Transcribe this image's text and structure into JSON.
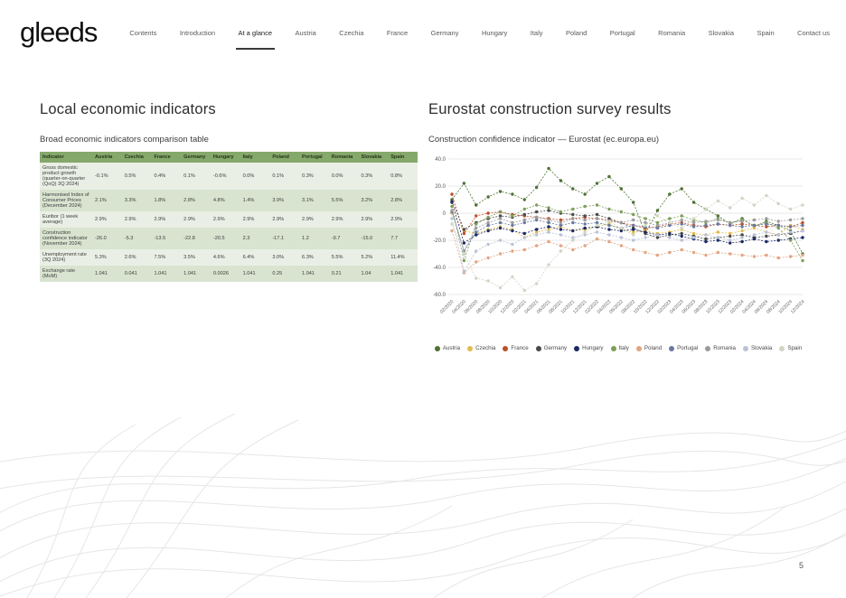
{
  "brand": {
    "logo": "gleeds"
  },
  "nav": {
    "items": [
      {
        "label": "Contents",
        "active": false
      },
      {
        "label": "Introduction",
        "active": false
      },
      {
        "label": "At a glance",
        "active": true
      },
      {
        "label": "Austria",
        "active": false
      },
      {
        "label": "Czechia",
        "active": false
      },
      {
        "label": "France",
        "active": false
      },
      {
        "label": "Germany",
        "active": false
      },
      {
        "label": "Hungary",
        "active": false
      },
      {
        "label": "Italy",
        "active": false
      },
      {
        "label": "Poland",
        "active": false
      },
      {
        "label": "Portugal",
        "active": false
      },
      {
        "label": "Romania",
        "active": false
      },
      {
        "label": "Slovakia",
        "active": false
      },
      {
        "label": "Spain",
        "active": false
      },
      {
        "label": "Contact us",
        "active": false
      }
    ]
  },
  "left": {
    "title": "Local economic indicators",
    "subtitle": "Broad economic indicators comparison table",
    "table": {
      "headers": [
        "Indicator",
        "Austria",
        "Czechia",
        "France",
        "Germany",
        "Hungary",
        "Italy",
        "Poland",
        "Portugal",
        "Romania",
        "Slovakia",
        "Spain"
      ],
      "rows": [
        {
          "indicator": "Gross domestic product growth (quarter-on-quarter (QoQ) 3Q 2024)",
          "values": [
            "-0.1%",
            "0.5%",
            "0.4%",
            "0.1%",
            "-0.6%",
            "0.0%",
            "0.1%",
            "0.3%",
            "0.0%",
            "0.3%",
            "0.8%"
          ]
        },
        {
          "indicator": "Harmonised Index of Consumer Prices (December 2024)",
          "values": [
            "2.1%",
            "3.3%",
            "1.8%",
            "2.8%",
            "4.8%",
            "1.4%",
            "3.9%",
            "3.1%",
            "5.5%",
            "3.2%",
            "2.8%"
          ]
        },
        {
          "indicator": "Euribor (1 week average)",
          "values": [
            "2.9%",
            "2.9%",
            "2.9%",
            "2.9%",
            "2.9%",
            "2.9%",
            "2.9%",
            "2.9%",
            "2.9%",
            "2.9%",
            "2.9%"
          ]
        },
        {
          "indicator": "Construction confidence indicator (November 2024)",
          "values": [
            "-26.0",
            "-5.3",
            "-13.5",
            "-22.8",
            "-20.5",
            "2.3",
            "-17.1",
            "1.2",
            "-9.7",
            "-15.0",
            "7.7"
          ]
        },
        {
          "indicator": "Unemployment rate (3Q 2024)",
          "values": [
            "5.3%",
            "2.6%",
            "7.5%",
            "3.5%",
            "4.6%",
            "6.4%",
            "3.0%",
            "6.3%",
            "5.5%",
            "5.2%",
            "11.4%"
          ]
        },
        {
          "indicator": "Exchange rate (MoM)",
          "values": [
            "1.041",
            "0.041",
            "1.041",
            "1.041",
            "0.0026",
            "1.041",
            "0.25",
            "1.041",
            "0.21",
            "1.04",
            "1.041"
          ]
        }
      ]
    }
  },
  "right": {
    "title": "Eurostat construction survey results",
    "subtitle": "Construction confidence indicator — Eurostat (ec.europa.eu)"
  },
  "chart_data": {
    "type": "line",
    "title": "Construction confidence indicator — Eurostat (ec.europa.eu)",
    "xlabel": "",
    "ylabel": "",
    "ylim": [
      -60,
      40
    ],
    "grid": true,
    "legend_position": "bottom",
    "x": [
      "02/2020",
      "04/2020",
      "06/2020",
      "08/2020",
      "10/2020",
      "12/2020",
      "02/2021",
      "04/2021",
      "06/2021",
      "08/2021",
      "10/2021",
      "12/2021",
      "02/2022",
      "04/2022",
      "06/2022",
      "08/2022",
      "10/2022",
      "12/2022",
      "02/2023",
      "04/2023",
      "06/2023",
      "08/2023",
      "10/2023",
      "12/2023",
      "02/2024",
      "04/2024",
      "06/2024",
      "08/2024",
      "10/2024",
      "12/2024"
    ],
    "series": [
      {
        "name": "Austria",
        "color": "#4e7233",
        "values": [
          10,
          22,
          6,
          12,
          16,
          14,
          10,
          19,
          33,
          24,
          18,
          14,
          22,
          27,
          18,
          8,
          -15,
          2,
          14,
          18,
          8,
          3,
          -2,
          -8,
          -4,
          -10,
          -6,
          -9,
          -13,
          -30
        ]
      },
      {
        "name": "Czechia",
        "color": "#e2bc4c",
        "values": [
          0,
          -13,
          -15,
          -12,
          -10,
          -12,
          -18,
          -14,
          -12,
          -10,
          -13,
          -12,
          -10,
          -8,
          -12,
          -14,
          -13,
          -15,
          -14,
          -12,
          -15,
          -16,
          -14,
          -15,
          -13,
          -11,
          -14,
          -16,
          -9,
          -12
        ]
      },
      {
        "name": "France",
        "color": "#bd4f2b",
        "values": [
          14,
          -15,
          -2,
          0,
          1,
          -1,
          -2,
          -3,
          -4,
          -5,
          -4,
          -3,
          -4,
          -5,
          -7,
          -9,
          -11,
          -10,
          -8,
          -7,
          -9,
          -10,
          -8,
          -9,
          -8,
          -9,
          -10,
          -9,
          -10,
          -7
        ]
      },
      {
        "name": "Germany",
        "color": "#4a4a4a",
        "values": [
          9,
          -12,
          -7,
          -4,
          -2,
          -3,
          -1,
          1,
          2,
          0,
          -1,
          -2,
          -1,
          -4,
          -7,
          -11,
          -15,
          -18,
          -16,
          -15,
          -17,
          -19,
          -18,
          -17,
          -16,
          -18,
          -17,
          -16,
          -15,
          -13
        ]
      },
      {
        "name": "Hungary",
        "color": "#1b2a63",
        "values": [
          8,
          -22,
          -16,
          -13,
          -11,
          -13,
          -15,
          -12,
          -10,
          -12,
          -13,
          -11,
          -10,
          -12,
          -13,
          -12,
          -14,
          -16,
          -15,
          -17,
          -19,
          -21,
          -20,
          -22,
          -21,
          -19,
          -21,
          -20,
          -19,
          -18
        ]
      },
      {
        "name": "Italy",
        "color": "#7e9e59",
        "values": [
          5,
          -35,
          -8,
          -3,
          1,
          -2,
          3,
          6,
          4,
          1,
          3,
          5,
          6,
          3,
          1,
          -1,
          -4,
          -7,
          -4,
          -2,
          -5,
          -7,
          -4,
          -7,
          -5,
          -9,
          -7,
          -11,
          -20,
          -35
        ]
      },
      {
        "name": "Poland",
        "color": "#e2a482",
        "values": [
          -13,
          -44,
          -36,
          -33,
          -30,
          -28,
          -27,
          -24,
          -21,
          -24,
          -27,
          -24,
          -19,
          -21,
          -24,
          -27,
          -29,
          -31,
          -29,
          -27,
          -29,
          -31,
          -29,
          -30,
          -31,
          -32,
          -31,
          -33,
          -32,
          -31
        ]
      },
      {
        "name": "Portugal",
        "color": "#68799f",
        "values": [
          1,
          -28,
          -14,
          -9,
          -7,
          -9,
          -7,
          -5,
          -7,
          -9,
          -7,
          -8,
          -7,
          -9,
          -11,
          -9,
          -10,
          -11,
          -9,
          -8,
          -10,
          -9,
          -8,
          -9,
          -10,
          -9,
          -8,
          -9,
          -10,
          -9
        ]
      },
      {
        "name": "Romania",
        "color": "#9b9b9b",
        "values": [
          2,
          -28,
          -11,
          -7,
          -4,
          -7,
          -5,
          -3,
          -5,
          -7,
          -4,
          -5,
          -4,
          -6,
          -7,
          -5,
          -7,
          -9,
          -7,
          -5,
          -7,
          -6,
          -5,
          -7,
          -6,
          -5,
          -4,
          -6,
          -5,
          -4
        ]
      },
      {
        "name": "Slovakia",
        "color": "#b9c2d8",
        "values": [
          -4,
          -43,
          -28,
          -23,
          -20,
          -23,
          -18,
          -16,
          -14,
          -16,
          -18,
          -16,
          -14,
          -16,
          -18,
          -20,
          -18,
          -16,
          -18,
          -20,
          -18,
          -16,
          -18,
          -20,
          -18,
          -16,
          -14,
          -16,
          -14,
          -13
        ]
      },
      {
        "name": "Spain",
        "color": "#cfd6c4",
        "values": [
          -8,
          -30,
          -48,
          -50,
          -55,
          -47,
          -57,
          -52,
          -38,
          -28,
          -20,
          -14,
          -9,
          -6,
          -11,
          -16,
          -9,
          -2,
          -7,
          -11,
          -4,
          3,
          9,
          4,
          11,
          6,
          13,
          7,
          3,
          6
        ]
      }
    ]
  },
  "footer": {
    "page_number": "5"
  }
}
